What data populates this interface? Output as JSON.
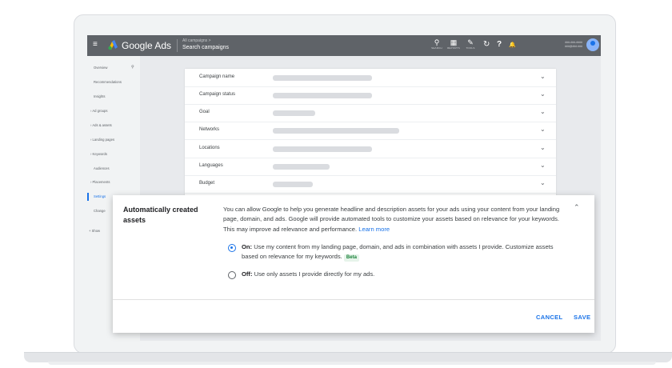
{
  "topbar": {
    "menu_glyph": "≡",
    "product_name": "Google Ads",
    "breadcrumb_small": "All campaigns >",
    "breadcrumb_main": "Search campaigns",
    "icons": [
      {
        "icon": "search-icon",
        "glyph": "⚲",
        "label": "SEARCH"
      },
      {
        "icon": "reports-icon",
        "glyph": "▦",
        "label": "REPORTS"
      },
      {
        "icon": "tools-icon",
        "glyph": "✎",
        "label": "TOOLS"
      }
    ],
    "refresh_glyph": "↻",
    "help_glyph": "?",
    "notifications_glyph": "🔔",
    "account_line1": "###-###-####",
    "account_line2": "###@###.###"
  },
  "sidebar": {
    "pin_glyph": "⚲",
    "items": [
      {
        "label": "Overview"
      },
      {
        "label": "Recommendations"
      },
      {
        "label": "Insights"
      },
      {
        "label": "› Ad groups"
      },
      {
        "label": "› Ads & assets"
      },
      {
        "label": "› Landing pages"
      },
      {
        "label": "› Keywords"
      },
      {
        "label": "Audiences"
      },
      {
        "label": "› Placements"
      },
      {
        "label": "Settings"
      },
      {
        "label": "Change"
      },
      {
        "label": "+ Show"
      }
    ]
  },
  "settings_rows": [
    {
      "label": "Campaign name",
      "bar_fraction": 0.4
    },
    {
      "label": "Campaign status",
      "bar_fraction": 0.4
    },
    {
      "label": "Goal",
      "bar_fraction": 0.17
    },
    {
      "label": "Networks",
      "bar_fraction": 0.51
    },
    {
      "label": "Locations",
      "bar_fraction": 0.4
    },
    {
      "label": "Languages",
      "bar_fraction": 0.23
    },
    {
      "label": "Budget",
      "bar_fraction": 0.16
    }
  ],
  "chevron_glyph": "⌄",
  "card": {
    "title": "Automatically created assets",
    "description": "You can allow Google to help you generate headline and description assets for your ads using your content from your landing page, domain, and ads. Google will provide automated tools to customize your assets based on relevance for your keywords. This may improve ad relevance and performance.",
    "learn_more": "Learn more",
    "collapse_glyph": "⌃",
    "option_on_label": "On:",
    "option_on_text": "Use my content from my landing page, domain, and ads in combination with assets I provide. Customize assets based on relevance for my keywords.",
    "beta_badge": "Beta",
    "option_off_label": "Off:",
    "option_off_text": "Use only assets I provide directly for my ads.",
    "cancel_label": "CANCEL",
    "save_label": "SAVE"
  },
  "colors": {
    "accent": "#1a73e8",
    "topbar": "#5f6368",
    "beta_bg": "#e6f4ea",
    "beta_text": "#188038"
  }
}
